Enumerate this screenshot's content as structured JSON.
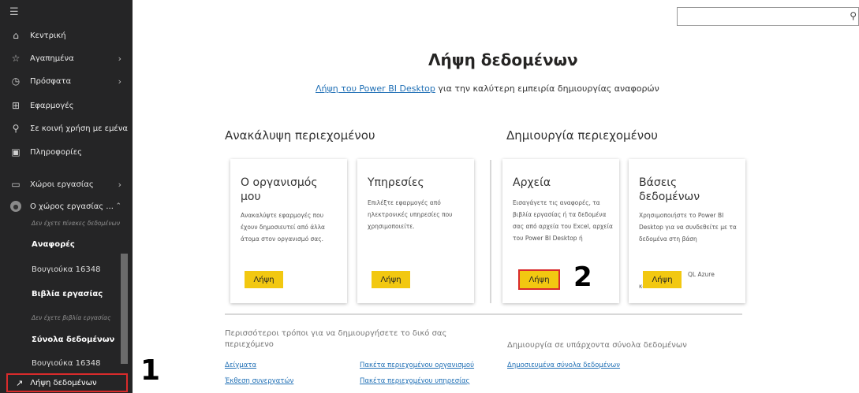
{
  "sidebar": {
    "items": [
      {
        "icon": "home-icon",
        "label": "Κεντρική"
      },
      {
        "icon": "star-icon",
        "label": "Αγαπημένα"
      },
      {
        "icon": "clock-icon",
        "label": "Πρόσφατα"
      },
      {
        "icon": "apps-icon",
        "label": "Εφαρμογές"
      },
      {
        "icon": "shared-icon",
        "label": "Σε κοινή χρήση με εμένα"
      },
      {
        "icon": "book-icon",
        "label": "Πληροφορίες"
      },
      {
        "icon": "workspaces-icon",
        "label": "Χώροι εργασίας"
      },
      {
        "icon": "avatar",
        "label": "Ο χώρος εργασίας ..."
      }
    ],
    "workspace": {
      "no_dashboards": "Δεν έχετε πίνακες δεδομένων",
      "reports_header": "Αναφορές",
      "report_item": "Βουγιούκα 16348",
      "workbooks_header": "Βιβλία εργασίας",
      "no_workbooks": "Δεν έχετε βιβλία εργασίας",
      "datasets_header": "Σύνολα δεδομένων",
      "dataset_item": "Βουγιούκα 16348"
    },
    "get_data": "Λήψη δεδομένων"
  },
  "steps": {
    "one": "1",
    "two": "2"
  },
  "main": {
    "title": "Λήψη δεδομένων",
    "subtitle_link": "Λήψη του Power BI Desktop",
    "subtitle_rest": " για την καλύτερη εμπειρία δημιουργίας αναφορών",
    "discover_heading": "Ανακάλυψη περιεχομένου",
    "create_heading": "Δημιουργία περιεχομένου",
    "tiles": [
      {
        "title": "Ο οργανισμός μου",
        "desc": "Ανακαλύψτε εφαρμογές που έχουν δημοσιευτεί από άλλα άτομα στον οργανισμό σας.",
        "button": "Λήψη"
      },
      {
        "title": "Υπηρεσίες",
        "desc": "Επιλέξτε εφαρμογές από ηλεκτρονικές υπηρεσίες που χρησιμοποιείτε.",
        "button": "Λήψη"
      },
      {
        "title": "Αρχεία",
        "desc": "Εισαγάγετε τις αναφορές, τα βιβλία εργασίας ή τα δεδομένα σας από αρχεία του Excel, αρχεία του Power BI Desktop ή",
        "button": "Λήψη"
      },
      {
        "title": "Βάσεις δεδομένων",
        "desc": "Χρησιμοποιήστε το Power BI Desktop για να συνδεθείτε με τα δεδομένα στη βάση",
        "desc_tail": "QL Azure",
        "desc_tail2": "και άλλα.",
        "button": "Λήψη"
      }
    ],
    "more_title": "Περισσότεροι τρόποι για να δημιουργήσετε το δικό σας περιεχόμενο",
    "more_right": "Δημιουργία σε υπάρχοντα σύνολα δεδομένων",
    "links": {
      "samples": "Δείγματα",
      "partner": "Έκθεση συνεργατών",
      "org_packs": "Πακέτα περιεχομένου οργανισμού",
      "service_packs": "Πακέτα περιεχομένου υπηρεσίας",
      "published": "Δημοσιευμένα σύνολα δεδομένων"
    }
  },
  "colors": {
    "sidebar": "#252526",
    "accent_button": "#f2c811",
    "highlight": "#d92b2b",
    "link": "#1f6fb5"
  }
}
